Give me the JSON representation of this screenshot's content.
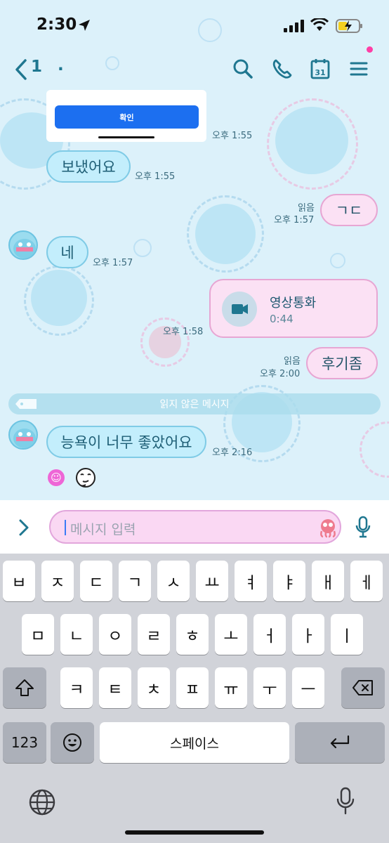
{
  "status_bar": {
    "time": "2:30"
  },
  "header": {
    "unread_count": "1",
    "room_name": "."
  },
  "popup": {
    "confirm_label": "확인"
  },
  "messages": [
    {
      "side": "in",
      "text": "보냈어요",
      "time": "오후 1:55"
    },
    {
      "side": "out",
      "text": "ㄱㄷ",
      "read": "읽음",
      "time": "오후 1:57"
    },
    {
      "side": "in",
      "text": "네",
      "time": "오후 1:57"
    },
    {
      "side": "out",
      "type": "video-call",
      "title": "영상통화",
      "duration": "0:44",
      "time": "오후 1:58"
    },
    {
      "side": "out",
      "text": "후기좀",
      "read": "읽음",
      "time": "오후 2:00"
    },
    {
      "side": "in",
      "text": "능욕이 너무 좋았어요",
      "time": "오후 2:16"
    }
  ],
  "popup_time": "오후 1:55",
  "unread_banner": "읽지 않은 메시지",
  "input": {
    "placeholder": "메시지 입력"
  },
  "keyboard": {
    "row1": [
      "ㅂ",
      "ㅈ",
      "ㄷ",
      "ㄱ",
      "ㅅ",
      "ㅛ",
      "ㅕ",
      "ㅑ",
      "ㅐ",
      "ㅔ"
    ],
    "row2": [
      "ㅁ",
      "ㄴ",
      "ㅇ",
      "ㄹ",
      "ㅎ",
      "ㅗ",
      "ㅓ",
      "ㅏ",
      "ㅣ"
    ],
    "row3": [
      "ㅋ",
      "ㅌ",
      "ㅊ",
      "ㅍ",
      "ㅠ",
      "ㅜ",
      "ㅡ"
    ],
    "numbers_label": "123",
    "space_label": "스페이스"
  },
  "colors": {
    "chat_background": "#dcf1fa",
    "incoming_bubble": "#c3eefc",
    "outgoing_bubble": "#fbe1f4",
    "accent_teal": "#1f7790",
    "confirm_button": "#1c6ff0",
    "notification_dot": "#ff3ea5"
  },
  "icons": {
    "header": [
      "back-icon",
      "search-icon",
      "phone-icon",
      "calendar-icon",
      "menu-icon"
    ],
    "calendar_day": "31"
  }
}
